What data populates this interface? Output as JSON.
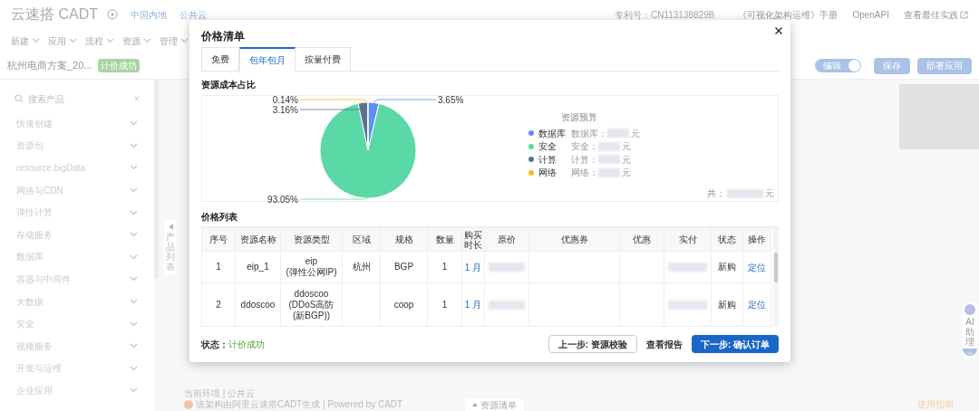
{
  "app": {
    "logo": "云速搭 CADT",
    "region_links": [
      "中国内地",
      "公共云"
    ],
    "patent": "专利号：CN113138829B",
    "top_links": [
      "《可视化架构运维》手册",
      "OpenAPI",
      "查看最佳实践"
    ],
    "menu": [
      "新建",
      "应用",
      "流程",
      "资源",
      "管理"
    ],
    "project_title": "杭州电商方案_20...",
    "project_badge": "计价成功",
    "edit_toggle": {
      "label": "编辑",
      "on": true
    },
    "buttons": [
      "保存",
      "部署应用"
    ],
    "search": {
      "placeholder": "搜索产品"
    },
    "sidebar_items": [
      "快速创建",
      "资源包",
      "resource.bigData",
      "网络与CDN",
      "弹性计算",
      "存储服务",
      "数据库",
      "容器与中间件",
      "大数据",
      "安全",
      "视频服务",
      "开发与运维",
      "企业应用"
    ],
    "product_list_tab": "产品列表",
    "ai_assistant": "AI助理",
    "environment": "当前环境 | 公共云",
    "generated_by": "该架构由阿里云速搭CADT生成 | Powered by CADT",
    "resource_list_tab": "资源清单",
    "guide_link": "使用指南"
  },
  "modal": {
    "title": "价格清单",
    "tabs": [
      {
        "label": "免费",
        "selected": false
      },
      {
        "label": "包年包月",
        "selected": true
      },
      {
        "label": "按量付费",
        "selected": false
      }
    ],
    "cost_section": {
      "title": "资源成本占比",
      "chart_data": {
        "type": "pie",
        "categories": [
          "数据库",
          "安全",
          "计算",
          "网络"
        ],
        "values": [
          3.65,
          93.05,
          3.16,
          0.14
        ],
        "value_labels": [
          "3.65%",
          "93.05%",
          "3.16%",
          "0.14%"
        ],
        "legend": {
          "title": "资源预算",
          "items": [
            {
              "color": "#5b8ff9",
              "label": "数据库：",
              "unit": "元",
              "redacted": true
            },
            {
              "color": "#5ad8a6",
              "label": "安全：",
              "unit": "元",
              "redacted": true
            },
            {
              "color": "#5d7092",
              "label": "计算：",
              "unit": "元",
              "redacted": true
            },
            {
              "color": "#f6bd16",
              "label": "网络：",
              "unit": "元",
              "redacted": true
            }
          ]
        }
      },
      "total": {
        "label": "共：",
        "unit": "元",
        "redacted": true
      }
    },
    "price_section": {
      "title": "价格列表",
      "columns": [
        "序号",
        "资源名称",
        "资源类型",
        "区域",
        "规格",
        "数量",
        "购买时长",
        "原价",
        "优惠券",
        "优惠",
        "实付",
        "状态",
        "操作"
      ],
      "rows": [
        {
          "cells": [
            {
              "kind": "text",
              "text": "1"
            },
            {
              "kind": "text",
              "text": "eip_1"
            },
            {
              "kind": "text",
              "text": "eip\n(弹性公网IP)"
            },
            {
              "kind": "text",
              "text": "杭州"
            },
            {
              "kind": "text",
              "text": "BGP"
            },
            {
              "kind": "text",
              "text": "1"
            },
            {
              "kind": "link",
              "text": "1 月"
            },
            {
              "kind": "redacted"
            },
            {
              "kind": "empty"
            },
            {
              "kind": "empty"
            },
            {
              "kind": "redacted"
            },
            {
              "kind": "text",
              "text": "新购"
            },
            {
              "kind": "link",
              "text": "定位"
            }
          ]
        },
        {
          "cells": [
            {
              "kind": "text",
              "text": "2"
            },
            {
              "kind": "text",
              "text": "ddoscoo"
            },
            {
              "kind": "text",
              "text": "ddoscoo\n(DDoS高防\n(新BGP))"
            },
            {
              "kind": "empty"
            },
            {
              "kind": "text",
              "text": "coop"
            },
            {
              "kind": "text",
              "text": "1"
            },
            {
              "kind": "link",
              "text": "1 月"
            },
            {
              "kind": "redacted"
            },
            {
              "kind": "empty"
            },
            {
              "kind": "empty"
            },
            {
              "kind": "redacted"
            },
            {
              "kind": "text",
              "text": "新购"
            },
            {
              "kind": "link",
              "text": "定位"
            }
          ]
        }
      ]
    },
    "footer": {
      "status_label": "状态：",
      "status_value": "计价成功",
      "buttons": [
        {
          "label": "上一步: 资源校验",
          "kind": "secondary"
        },
        {
          "label": "查看报告",
          "kind": "text"
        },
        {
          "label": "下一步: 确认订单",
          "kind": "primary"
        }
      ]
    }
  }
}
